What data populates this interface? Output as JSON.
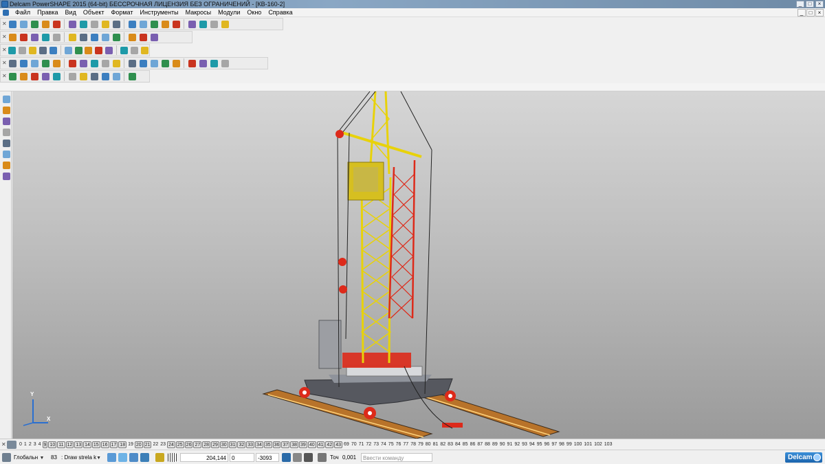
{
  "window": {
    "title": "Delcam PowerSHAPE 2015 (64-bit) БЕССРОЧНАЯ ЛИЦЕНЗИЯ БЕЗ ОГРАНИЧЕНИЙ - [КВ-160-2]",
    "controls": [
      "_",
      "□",
      "×"
    ],
    "mdi_controls": [
      "_",
      "□",
      "×"
    ]
  },
  "menu": {
    "items": [
      "Файл",
      "Правка",
      "Вид",
      "Объект",
      "Формат",
      "Инструменты",
      "Макросы",
      "Модули",
      "Окно",
      "Справка"
    ]
  },
  "toolbars": {
    "rows": [
      {
        "name": "toolbar-main",
        "icons": [
          "new-icon",
          "open-icon",
          "save-icon",
          "print-icon",
          "cut-icon",
          "copy-icon",
          "paste-icon",
          "delete-icon",
          "undo-icon",
          "redo-icon",
          "measure-icon",
          "view-icon",
          "select-icon",
          "rotate-icon",
          "sphere-icon",
          "lasso-icon",
          "shade-icon",
          "light-icon",
          "tools-icon"
        ]
      },
      {
        "name": "toolbar-view",
        "icons": [
          "view-top-icon",
          "view-front-icon",
          "view-side-icon",
          "view-iso-icon",
          "zoom-icon",
          "zoom-window-icon",
          "zoom-fit-icon",
          "pan-icon",
          "shade-icon",
          "wireframe-icon",
          "render-icon",
          "light-icon",
          "hand-icon"
        ]
      },
      {
        "name": "toolbar-objects",
        "icons": [
          "workplane-icon",
          "level-icon",
          "file-icon",
          "sphere-red-icon",
          "sphere-green-icon",
          "sphere-multi-icon",
          "cone-icon",
          "arrow-icon",
          "box-icon",
          "assembly-icon",
          "import-icon",
          "export-icon",
          "tool-icon"
        ]
      },
      {
        "name": "toolbar-surfaces",
        "icons": [
          "surface-icon",
          "surface2-icon",
          "solid-icon",
          "solid2-icon",
          "solid3-icon",
          "solid4-icon",
          "fillet-icon",
          "extrude-icon",
          "revolve-icon",
          "sweep-icon",
          "loft-icon",
          "shell-icon",
          "boolean-icon",
          "split-icon",
          "mirror-icon",
          "pattern-icon",
          "hole-icon",
          "draft-icon",
          "thicken-icon"
        ]
      },
      {
        "name": "toolbar-misc",
        "icons": [
          "dimension-icon",
          "grid-icon",
          "align-icon",
          "anchor-icon",
          "part-icon",
          "group-icon",
          "camera-icon",
          "chart-icon",
          "color-icon",
          "material-icon",
          "texture-icon"
        ]
      }
    ]
  },
  "left_toolbar": {
    "icons": [
      "select-arrow-icon",
      "select-window-icon",
      "workplane-icon",
      "workplane-edit-icon",
      "sphere-icon",
      "ruler-icon",
      "axis-icon",
      "move-icon"
    ]
  },
  "viewport": {
    "axis_labels": [
      "Y",
      "X"
    ],
    "colors": {
      "crane_yellow": "#e8d20a",
      "crane_red": "#dd2a1a",
      "base_gray": "#5d5f66",
      "rail_orange": "#c07a2a",
      "cabinet_gray": "#9c9ea3"
    }
  },
  "level_bar": {
    "levels": [
      "0",
      "1",
      "2",
      "3",
      "4",
      "9",
      "10",
      "11",
      "12",
      "13",
      "14",
      "15",
      "16",
      "17",
      "18",
      "19",
      "20",
      "21",
      "22",
      "23",
      "24",
      "25",
      "26",
      "27",
      "28",
      "29",
      "30",
      "31",
      "32",
      "33",
      "34",
      "35",
      "36",
      "37",
      "38",
      "39",
      "40",
      "41",
      "42",
      "43",
      "69",
      "70",
      "71",
      "72",
      "73",
      "74",
      "75",
      "76",
      "77",
      "78",
      "79",
      "80",
      "81",
      "82",
      "83",
      "84",
      "85",
      "86",
      "87",
      "88",
      "89",
      "90",
      "91",
      "92",
      "93",
      "94",
      "95",
      "96",
      "97",
      "98",
      "99",
      "100",
      "101",
      "102",
      "103"
    ],
    "active_levels": [
      "9",
      "10",
      "11",
      "12",
      "13",
      "14",
      "15",
      "16",
      "17",
      "18",
      "20",
      "21",
      "24",
      "25",
      "26",
      "27",
      "28",
      "29",
      "30",
      "31",
      "32",
      "33",
      "34",
      "35",
      "36",
      "37",
      "38",
      "39",
      "40",
      "41",
      "42",
      "43"
    ]
  },
  "status_bar": {
    "workplane": "Глобальн",
    "level_number": "83",
    "level_name": "Draw strela k",
    "coord_x": "204,144",
    "coord_y": "0",
    "coord_z": "-3093",
    "tolerance_label": "Точ",
    "tolerance_value": "0,001",
    "command_placeholder": "Ввести команду",
    "brand": "Delcam"
  }
}
